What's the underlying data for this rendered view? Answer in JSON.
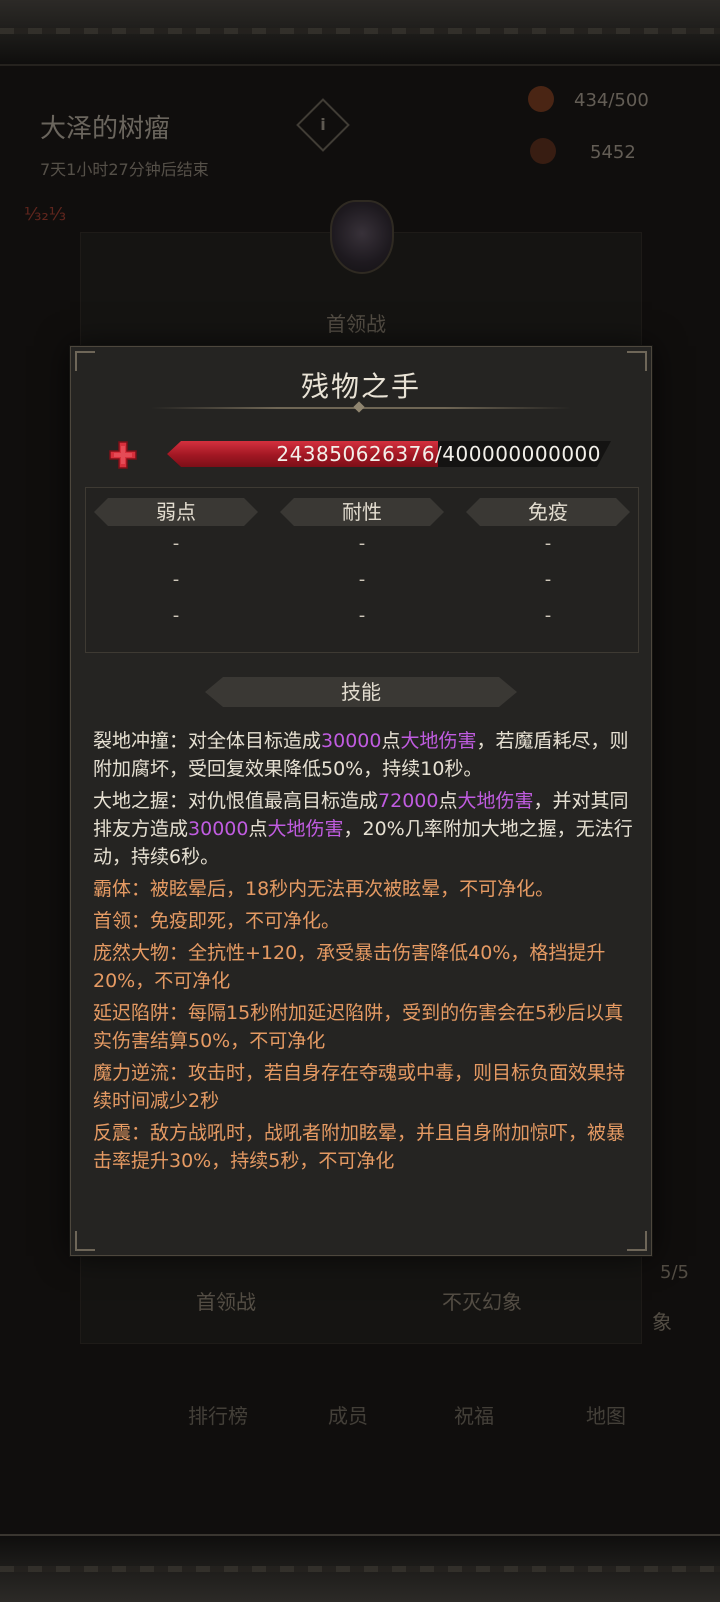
{
  "background": {
    "event_title": "大泽的树瘤",
    "event_timer": "7天1小时27分钟后结束",
    "info_glyph": "i",
    "resource1": "434/500",
    "resource2": "5452",
    "debuff_text": "⅓₂⅓",
    "boss_section_label": "首领战",
    "bottom_tab1": "首领战",
    "bottom_tab2": "不灭幻象",
    "page_counter": "5/5",
    "side_label": "象",
    "nav": [
      "排行榜",
      "成员",
      "祝福",
      "地图"
    ]
  },
  "modal": {
    "title": "残物之手",
    "hp": {
      "current_text": "243850626376",
      "max_text": "400000000000",
      "current": 243850626376,
      "max": 400000000000
    },
    "resist_headers": [
      "弱点",
      "耐性",
      "免疫"
    ],
    "resist_rows": [
      [
        "-",
        "-",
        "-"
      ],
      [
        "-",
        "-",
        "-"
      ],
      [
        "-",
        "-",
        "-"
      ]
    ],
    "skills_header": "技能",
    "skills": [
      {
        "parts": [
          {
            "t": "裂地冲撞：对全体目标造成",
            "c": "white"
          },
          {
            "t": "30000",
            "c": "purple"
          },
          {
            "t": "点",
            "c": "white"
          },
          {
            "t": "大地伤害",
            "c": "purple"
          },
          {
            "t": "，若魔盾耗尽，则附加腐坏，受回复效果降低50%，持续10秒。",
            "c": "white"
          }
        ]
      },
      {
        "parts": [
          {
            "t": "大地之握：对仇恨值最高目标造成",
            "c": "white"
          },
          {
            "t": "72000",
            "c": "purple"
          },
          {
            "t": "点",
            "c": "white"
          },
          {
            "t": "大地伤害",
            "c": "purple"
          },
          {
            "t": "，并对其同排友方造成",
            "c": "white"
          },
          {
            "t": "30000",
            "c": "purple"
          },
          {
            "t": "点",
            "c": "white"
          },
          {
            "t": "大地伤害",
            "c": "purple"
          },
          {
            "t": "，20%几率附加大地之握，无法行动，持续6秒。",
            "c": "white"
          }
        ]
      },
      {
        "parts": [
          {
            "t": "霸体：被眩晕后，18秒内无法再次被眩晕，不可净化。",
            "c": "orange"
          }
        ]
      },
      {
        "parts": [
          {
            "t": "首领：免疫即死，不可净化。",
            "c": "orange"
          }
        ]
      },
      {
        "parts": [
          {
            "t": "庞然大物：全抗性+120，承受暴击伤害降低40%，格挡提升20%，不可净化",
            "c": "orange"
          }
        ]
      },
      {
        "parts": [
          {
            "t": "延迟陷阱：每隔15秒附加延迟陷阱，受到的伤害会在5秒后以真实伤害结算50%，不可净化",
            "c": "orange"
          }
        ]
      },
      {
        "parts": [
          {
            "t": "魔力逆流：攻击时，若自身存在夺魂或中毒，则目标负面效果持续时间减少2秒",
            "c": "orange"
          }
        ]
      },
      {
        "parts": [
          {
            "t": "反震：敌方战吼时，战吼者附加眩晕，并且自身附加惊吓，被暴击率提升30%，持续5秒，不可净化",
            "c": "orange"
          }
        ]
      }
    ]
  },
  "colors": {
    "purple": "#c05ce0",
    "orange": "#e59a63",
    "hp_red": "#b3202c"
  },
  "icons": {
    "hp": "red-cross-icon",
    "info": "info-icon",
    "boss": "boss-crest-icon"
  }
}
